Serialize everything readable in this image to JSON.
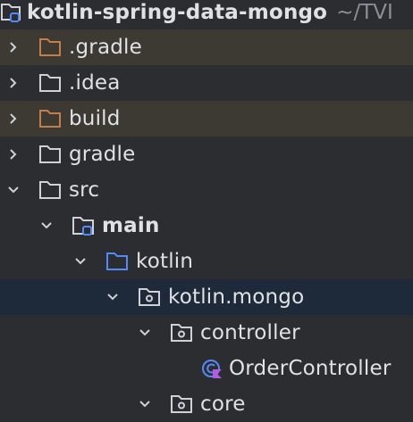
{
  "project": {
    "name": "kotlin-spring-data-mongo",
    "path_hint": "~/TVI"
  },
  "tree": [
    {
      "label": ".gradle",
      "icon": "folder-excluded",
      "state": "collapsed"
    },
    {
      "label": ".idea",
      "icon": "folder",
      "state": "collapsed"
    },
    {
      "label": "build",
      "icon": "folder-excluded",
      "state": "collapsed"
    },
    {
      "label": "gradle",
      "icon": "folder",
      "state": "collapsed"
    },
    {
      "label": "src",
      "icon": "folder",
      "state": "expanded"
    },
    {
      "label": "main",
      "icon": "module-folder",
      "state": "expanded"
    },
    {
      "label": "kotlin",
      "icon": "source-root-folder",
      "state": "expanded"
    },
    {
      "label": "kotlin.mongo",
      "icon": "package-folder",
      "state": "expanded",
      "selected": true
    },
    {
      "label": "controller",
      "icon": "package-folder",
      "state": "expanded"
    },
    {
      "label": "OrderController",
      "icon": "kotlin-class-icon",
      "state": "leaf"
    },
    {
      "label": "core",
      "icon": "package-folder",
      "state": "expanded"
    }
  ],
  "colors": {
    "background": "#2b2d30",
    "excluded_row": "#3d3a34",
    "selected_row": "#1e2a3a",
    "excluded_folder": "#c27d4a",
    "source_root": "#548af7"
  }
}
